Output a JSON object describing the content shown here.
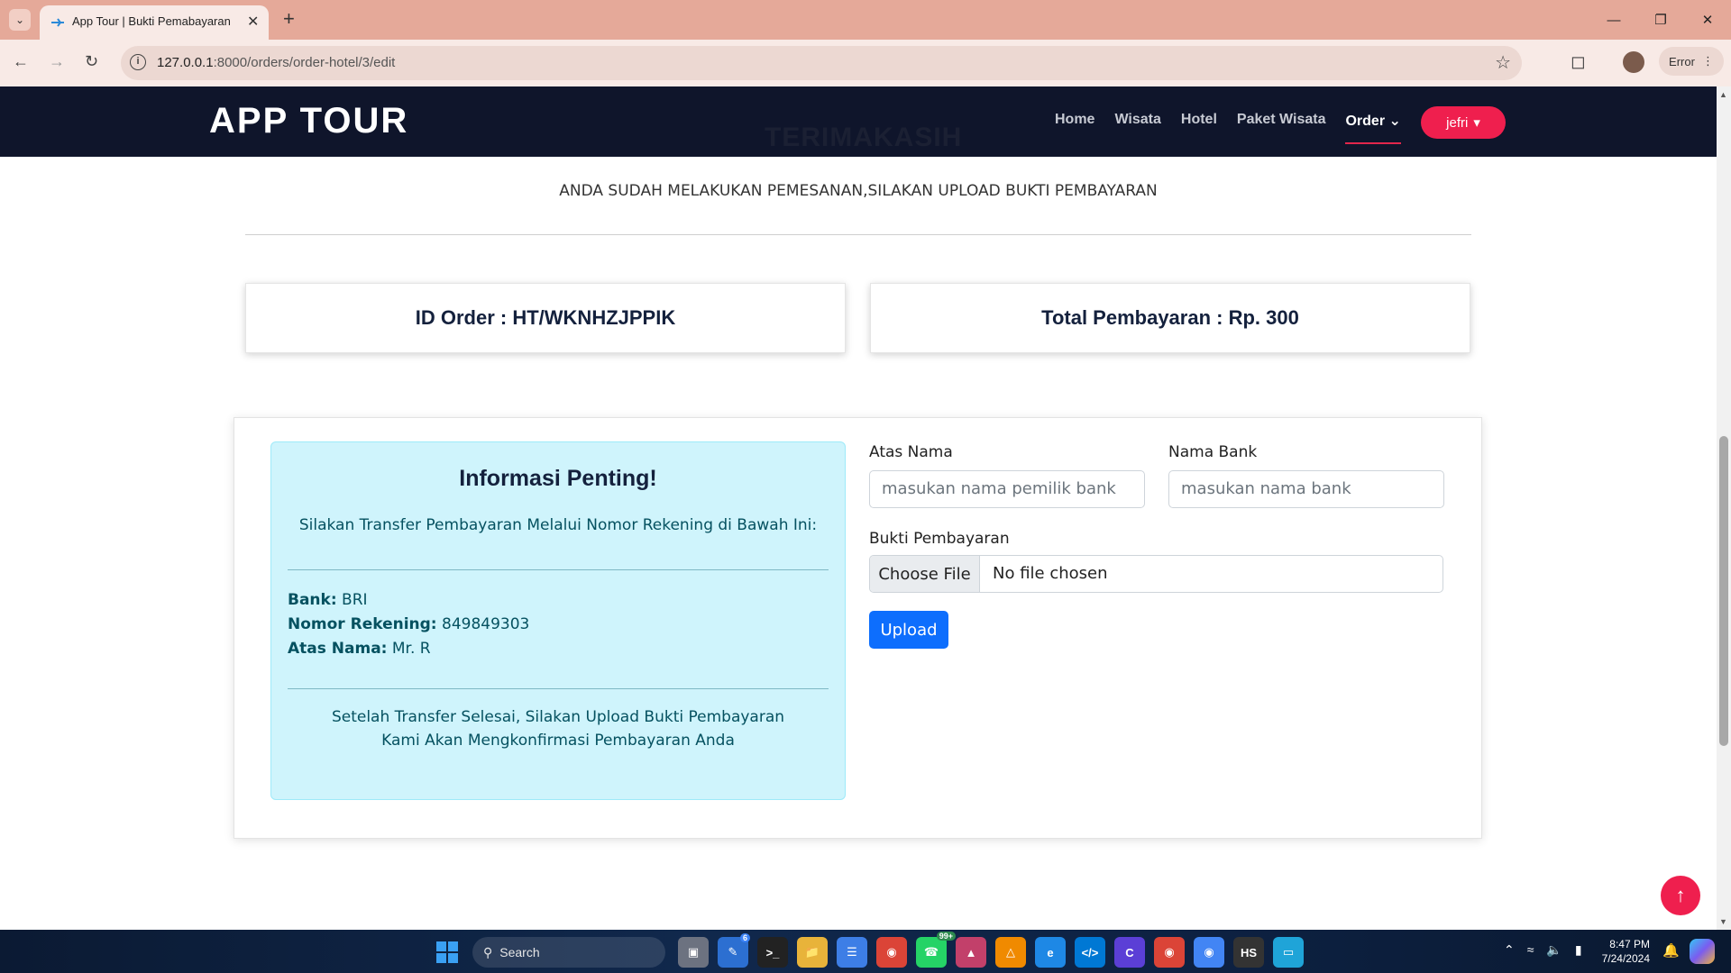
{
  "browser": {
    "tab_title": "App Tour | Bukti Pemabayaran",
    "url_host": "127.0.0.1",
    "url_rest": ":8000/orders/order-hotel/3/edit",
    "profile_status": "Error"
  },
  "site": {
    "brand": "APP TOUR",
    "hidden_heading": "TERIMAKASIH",
    "menu": [
      "Home",
      "Wisata",
      "Hotel",
      "Paket Wisata",
      "Order"
    ],
    "user": "jefri"
  },
  "page": {
    "notice": "ANDA SUDAH MELAKUKAN PEMESANAN,SILAKAN UPLOAD BUKTI PEMBAYARAN",
    "order_id": "ID Order : HT/WKNHZJPPIK",
    "total": "Total Pembayaran : Rp. 300"
  },
  "info": {
    "title": "Informasi Penting!",
    "subtitle": "Silakan Transfer Pembayaran Melalui Nomor Rekening di Bawah Ini:",
    "bank_label": "Bank:",
    "bank_value": "BRI",
    "account_label": "Nomor Rekening:",
    "account_value": "849849303",
    "name_label": "Atas Nama:",
    "name_value": "Mr. R",
    "footer_line1": "Setelah Transfer Selesai, Silakan Upload Bukti Pembayaran",
    "footer_line2": "Kami Akan Mengkonfirmasi Pembayaran Anda"
  },
  "form": {
    "account_name_label": "Atas Nama",
    "account_name_placeholder": "masukan nama pemilik bank",
    "bank_name_label": "Nama Bank",
    "bank_name_placeholder": "masukan nama bank",
    "proof_label": "Bukti Pembayaran",
    "choose_file": "Choose File",
    "no_file": "No file chosen",
    "upload": "Upload"
  },
  "taskbar": {
    "search": "Search",
    "whatsapp_badge": "99+",
    "badge_6": "6",
    "time": "8:47 PM",
    "date": "7/24/2024"
  }
}
